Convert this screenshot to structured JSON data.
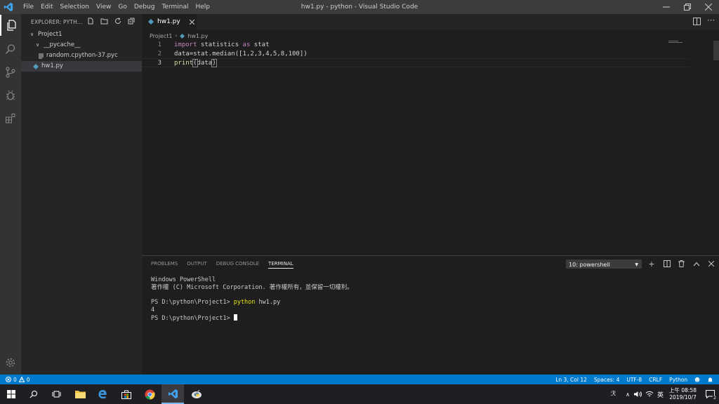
{
  "window": {
    "title": "hw1.py - python - Visual Studio Code",
    "menu": [
      "File",
      "Edit",
      "Selection",
      "View",
      "Go",
      "Debug",
      "Terminal",
      "Help"
    ]
  },
  "sidebar": {
    "header": "EXPLORER: PYTH...",
    "tree": [
      {
        "label": "Project1",
        "kind": "folder-open",
        "depth": 0
      },
      {
        "label": "__pycache__",
        "kind": "folder-open",
        "depth": 1
      },
      {
        "label": "random.cpython-37.pyc",
        "kind": "file",
        "depth": 2
      },
      {
        "label": "hw1.py",
        "kind": "python",
        "depth": 1
      }
    ]
  },
  "editor": {
    "tab_label": "hw1.py",
    "breadcrumb": [
      "Project1",
      "hw1.py"
    ],
    "line_numbers": [
      "1",
      "2",
      "3"
    ],
    "lines": {
      "l1_kw1": "import",
      "l1_mod": " statistics ",
      "l1_kw2": "as",
      "l1_alias": " stat",
      "l2_var": "data",
      "l2_eq": "=stat.",
      "l2_fn": "median",
      "l2_open": "([",
      "l2_nums": "1,2,3,4,5,8,100",
      "l2_close": "])",
      "l3_fn": "print",
      "l3_open": "(",
      "l3_var": "data",
      "l3_close": ")"
    }
  },
  "panel": {
    "tabs": [
      "PROBLEMS",
      "OUTPUT",
      "DEBUG CONSOLE",
      "TERMINAL"
    ],
    "active_tab": "TERMINAL",
    "terminal_select": "10: powershell",
    "terminal": {
      "line1": "Windows PowerShell",
      "line2": "著作權 (C) Microsoft Corporation. 著作權所有，並保留一切權利。",
      "prompt1": "PS D:\\python\\Project1> ",
      "cmd1": "python",
      "cmd1_arg": " hw1.py",
      "output": "4",
      "prompt2": "PS D:\\python\\Project1> "
    }
  },
  "statusbar": {
    "errors": "0",
    "warnings": "0",
    "position": "Ln 3, Col 12",
    "spaces": "Spaces: 4",
    "encoding": "UTF-8",
    "eol": "CRLF",
    "language": "Python"
  },
  "taskbar": {
    "time": "上午 08:58",
    "date": "2019/10/7",
    "ime": "英",
    "notifications": "2"
  },
  "colors": {
    "accent": "#007acc",
    "editor_bg": "#1e1e1e",
    "sidebar_bg": "#252526",
    "activity_bg": "#333333",
    "titlebar_bg": "#3c3c3c"
  }
}
